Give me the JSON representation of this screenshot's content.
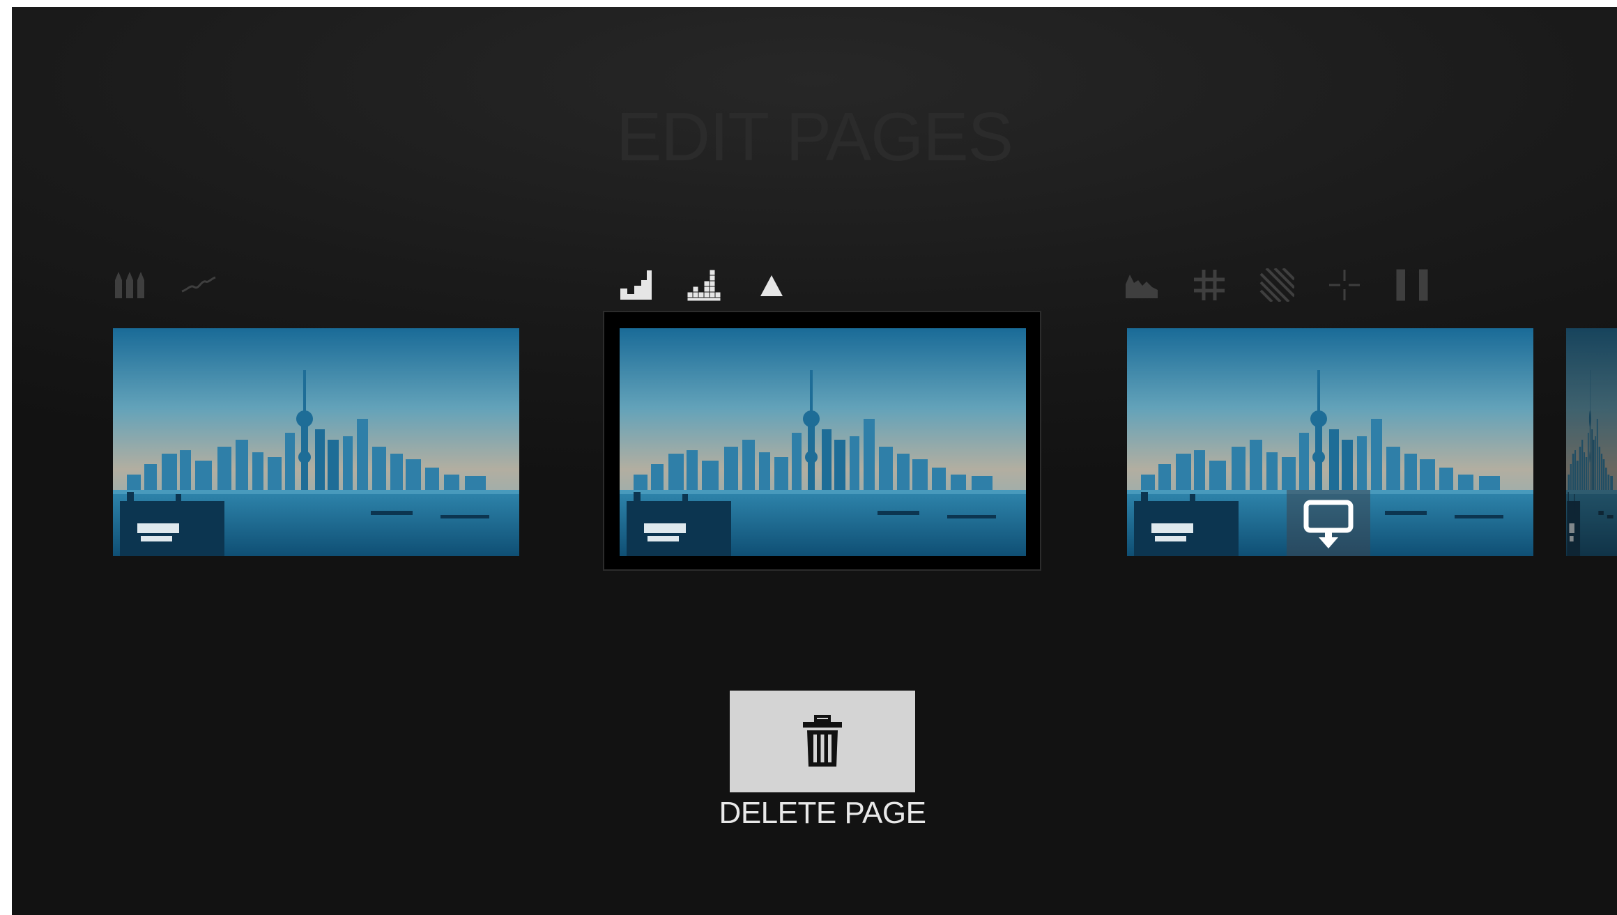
{
  "title": "EDIT PAGES",
  "pages": [
    {
      "id": "left-edge",
      "tools": []
    },
    {
      "id": "page-1",
      "tools": [
        "bars-peaks-icon",
        "line-chart-icon"
      ]
    },
    {
      "id": "page-2",
      "selected": true,
      "tools": [
        "step-histogram-icon",
        "dot-histogram-icon",
        "triangle-icon"
      ]
    },
    {
      "id": "page-3",
      "tools": [
        "area-chart-icon",
        "grid-icon",
        "hatch-icon",
        "crosshair-icon",
        "brackets-icon"
      ],
      "overlay": "monitor-download-icon"
    },
    {
      "id": "right-edge",
      "tools": []
    }
  ],
  "delete": {
    "label": "DELETE PAGE",
    "icon": "trash-icon"
  },
  "colors": {
    "active_icon": "#e6e6e6",
    "dim_icon": "#3f3f3f",
    "title": "#2b2b2b",
    "button_bg": "#d4d4d4"
  }
}
